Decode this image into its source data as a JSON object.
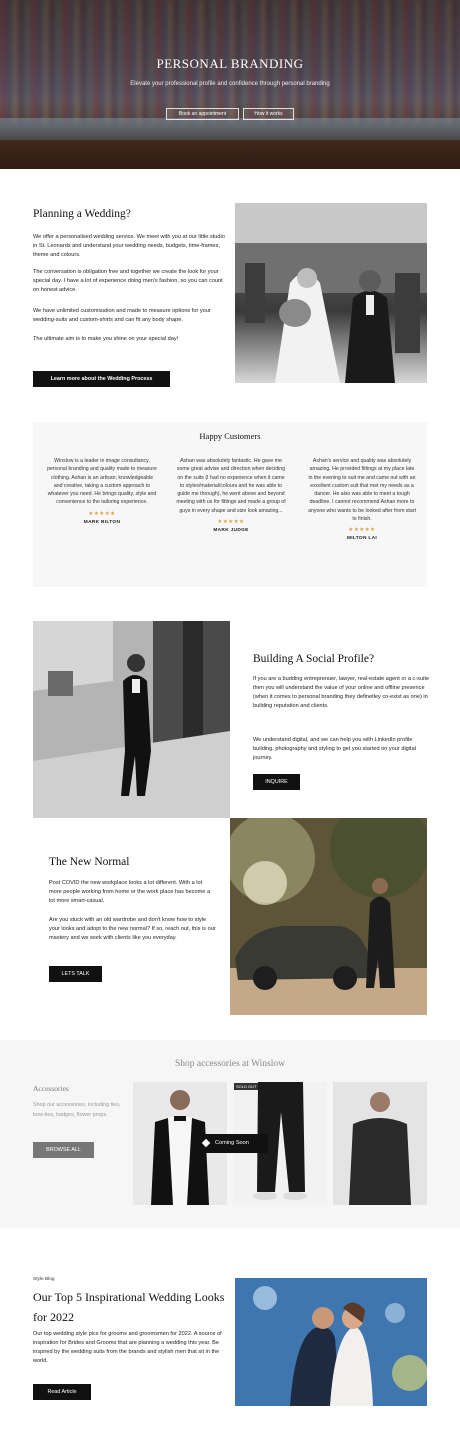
{
  "hero": {
    "title": "PERSONAL BRANDING",
    "subtitle": "Elevate your professional profile and confidence through personal branding",
    "btn_appointment": "Book an appointment",
    "btn_how": "How it works"
  },
  "wedding": {
    "title": "Planning a Wedding?",
    "p1": "We offer a personalised wedding service. We meet with you at our little studio in St. Leonards and understand your wedding needs, budgets, time-frames, theme and colours.",
    "p2": "The conversation is obligation free and together we create the look for your special day. I have a lot of experience doing men's fashion, so you can count on honest advice.",
    "p3": "We have unlimited customisation and made to measure options for your wedding-suits and custom-shirts and can fit any body shape.",
    "p4": "The ultimate aim is to make you shine on your special day!",
    "button": "Learn more about the Wedding Process"
  },
  "testimonials": {
    "title": "Happy Customers",
    "items": [
      {
        "text": "Winslow is a leader in image consultancy, personal branding and quality made to measure clothing. Ashan is an artisan; knowledgeable and creative, taking a custom approach to whatever you need. He brings quality, style and convenience to the tailoring experience.",
        "stars": "★★★★★",
        "name": "MARK BILTON"
      },
      {
        "text": "Ashan was absolutely fantastic. He gave me some great advise and direction when deciding on the suits (I had no experience when it came to styles/material/colours and he was able to guide me through), he went above and beyond meeting with us for fittings and made a group of guys in every shape and size look amazing...",
        "stars": "★★★★★",
        "name": "MARK JUDGE"
      },
      {
        "text": "Ashan's service and quality was absolutely amazing. He provided fittings at my place late in the evening to suit me and came out with an excellent custom suit that met my needs as a dancer. He also was able to meet a tough deadline. I cannot recommend Ashan more to anyone who wants to be looked after from start to finish.",
        "stars": "★★★★★",
        "name": "MILTON LAI"
      }
    ]
  },
  "social": {
    "title": "Building A Social Profile?",
    "p1": "If you are a budding entreprenuer, lawyer, real-estate agent or a c-suite then you will understand the value of your online and offline presence (when it comes to personal branding they definetley co-exist as one) in building reputation and clients.",
    "p2": "We understand digital, and we can help you with LinkedIn profile building, photography and styling to get you started on your digital journey.",
    "button": "INQUIRE"
  },
  "new_normal": {
    "title": "The New Normal",
    "p1": "Post COVID the new workplace looks a lot different. With a lot more people working from home or the work place has become a lot more smart-casual.",
    "p2": "Are you stuck with an old wardrobe and don't know how to style your looks and adopt to the new normal? If so, reach out, this is our mastery and we work with clients like you everyday.",
    "button": "LETS TALK"
  },
  "accessories": {
    "title": "Shop accessories at Winslow",
    "side_title": "Accessories",
    "side_text": "Shop our accessories, including ties, bow-ties, badges, flower props.",
    "button": "BROWSE ALL",
    "sold_out": "SOLD OUT",
    "coming_soon": "Coming Soon"
  },
  "blog": {
    "tag": "Style Blog",
    "title": "Our Top 5 Inspirational Wedding Looks for 2022",
    "text": "Our top wedding style pics for grooms and groomsmen for 2022. A source of inspiration for Brides and Grooms that are planning a wedding this year. Be inspired by the wedding suits from the brands and stylish men that sit in the world.",
    "button": "Read Article"
  },
  "colors": {
    "accent": "#111111",
    "star": "#e0a040",
    "grey_button": "#777777"
  }
}
